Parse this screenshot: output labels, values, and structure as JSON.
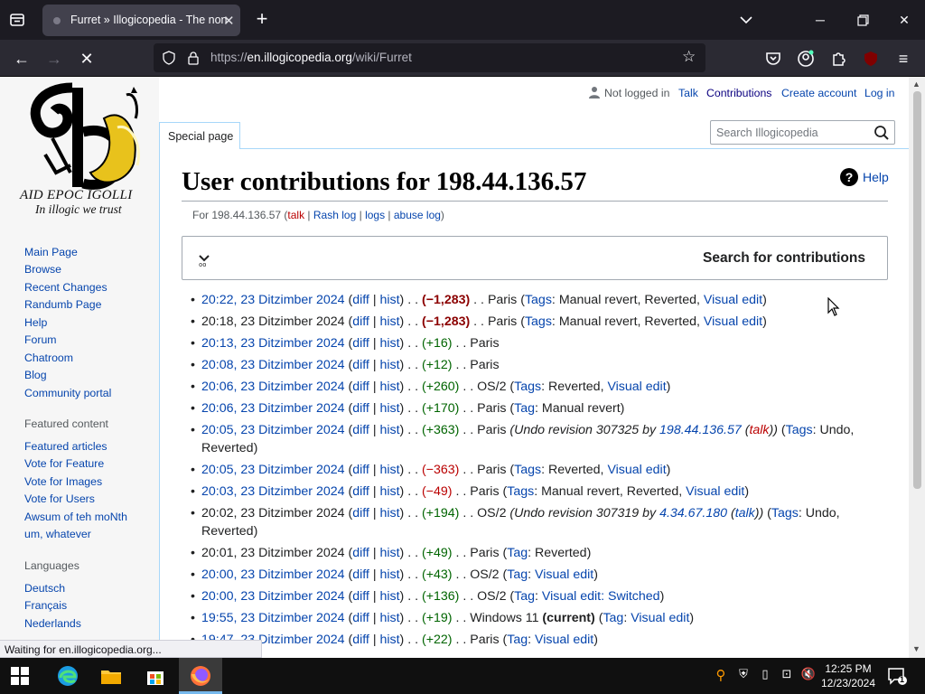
{
  "browser": {
    "tab_title": "Furret » Illogicopedia - The non",
    "url_host": "en.illogicopedia.org",
    "url_prefix": "https://",
    "url_path": "/wiki/Furret",
    "status_text": "Waiting for en.illogicopedia.org..."
  },
  "logo": {
    "line1": "AID EPOC IGOLLI",
    "line2": "In illogic we trust"
  },
  "sidebar": {
    "nav": [
      "Main Page",
      "Browse",
      "Recent Changes",
      "Randumb Page",
      "Help",
      "Forum",
      "Chatroom",
      "Blog",
      "Community portal"
    ],
    "featured_heading": "Featured content",
    "featured": [
      "Featured articles",
      "Vote for Feature",
      "Vote for Images",
      "Vote for Users",
      "Awsum of teh moNth",
      "um, whatever"
    ],
    "languages_heading": "Languages",
    "languages": [
      "Deutsch",
      "Français",
      "Nederlands"
    ]
  },
  "personal": {
    "not_logged_in": "Not logged in",
    "talk": "Talk",
    "contributions": "Contributions",
    "create_account": "Create account",
    "log_in": "Log in"
  },
  "search": {
    "placeholder": "Search Illogicopedia"
  },
  "tabs": {
    "special_page": "Special page"
  },
  "page": {
    "title": "User contributions for 198.44.136.57",
    "help": "Help",
    "for_label": "For 198.44.136.57 (",
    "talk": "talk",
    "rash_log": "Rash log",
    "logs": "logs",
    "abuse_log": "abuse log",
    "close_paren": ")",
    "search_contribs": "Search for contributions"
  },
  "contributions": [
    {
      "time": "20:22, 23 Ditzimber 2024",
      "linked": true,
      "diff": "diff",
      "hist": "hist",
      "size": "−1,283",
      "neg": true,
      "big": true,
      "page": "Paris",
      "tagword": "Tags",
      "tags": "Manual revert, Reverted, ",
      "tag_link": "Visual edit",
      "tag_tail": "",
      "note": ""
    },
    {
      "time": "20:18, 23 Ditzimber 2024",
      "linked": false,
      "diff": "diff",
      "hist": "hist",
      "size": "−1,283",
      "neg": true,
      "big": true,
      "page": "Paris",
      "tagword": "Tags",
      "tags": "Manual revert, Reverted, ",
      "tag_link": "Visual edit",
      "tag_tail": "",
      "note": ""
    },
    {
      "time": "20:13, 23 Ditzimber 2024",
      "linked": true,
      "diff": "diff",
      "hist": "hist",
      "size": "+16",
      "neg": false,
      "big": false,
      "page": "Paris",
      "tagword": "",
      "tags": "",
      "tag_link": "",
      "tag_tail": "",
      "note": ""
    },
    {
      "time": "20:08, 23 Ditzimber 2024",
      "linked": true,
      "diff": "diff",
      "hist": "hist",
      "size": "+12",
      "neg": false,
      "big": false,
      "page": "Paris",
      "tagword": "",
      "tags": "",
      "tag_link": "",
      "tag_tail": "",
      "note": ""
    },
    {
      "time": "20:06, 23 Ditzimber 2024",
      "linked": true,
      "diff": "diff",
      "hist": "hist",
      "size": "+260",
      "neg": false,
      "big": false,
      "page": "OS/2",
      "tagword": "Tags",
      "tags": "Reverted, ",
      "tag_link": "Visual edit",
      "tag_tail": "",
      "note": ""
    },
    {
      "time": "20:06, 23 Ditzimber 2024",
      "linked": true,
      "diff": "diff",
      "hist": "hist",
      "size": "+170",
      "neg": false,
      "big": false,
      "page": "Paris",
      "tagword": "Tag",
      "tags": "Manual revert",
      "tag_link": "",
      "tag_tail": "",
      "note": ""
    },
    {
      "time": "20:05, 23 Ditzimber 2024",
      "linked": true,
      "diff": "diff",
      "hist": "hist",
      "size": "+363",
      "neg": false,
      "big": false,
      "page": "Paris",
      "tagword": "Tags",
      "tags": "Undo, Reverted",
      "tag_link": "",
      "tag_tail": "",
      "note": "Undo revision 307325 by ",
      "note_user": "198.44.136.57",
      "note_talk": "talk",
      "note_talk_red": true
    },
    {
      "time": "20:05, 23 Ditzimber 2024",
      "linked": true,
      "diff": "diff",
      "hist": "hist",
      "size": "−363",
      "neg": true,
      "big": false,
      "page": "Paris",
      "tagword": "Tags",
      "tags": "Reverted, ",
      "tag_link": "Visual edit",
      "tag_tail": "",
      "note": ""
    },
    {
      "time": "20:03, 23 Ditzimber 2024",
      "linked": true,
      "diff": "diff",
      "hist": "hist",
      "size": "−49",
      "neg": true,
      "big": false,
      "page": "Paris",
      "tagword": "Tags",
      "tags": "Manual revert, Reverted, ",
      "tag_link": "Visual edit",
      "tag_tail": "",
      "note": ""
    },
    {
      "time": "20:02, 23 Ditzimber 2024",
      "linked": false,
      "diff": "diff",
      "hist": "hist",
      "size": "+194",
      "neg": false,
      "big": false,
      "page": "OS/2",
      "tagword": "Tags",
      "tags": "Undo, Reverted",
      "tag_link": "",
      "tag_tail": "",
      "note": "Undo revision 307319 by ",
      "note_user": "4.34.67.180",
      "note_talk": "talk",
      "note_talk_red": false
    },
    {
      "time": "20:01, 23 Ditzimber 2024",
      "linked": false,
      "diff": "diff",
      "hist": "hist",
      "size": "+49",
      "neg": false,
      "big": false,
      "page": "Paris",
      "tagword": "Tag",
      "tags": "Reverted",
      "tag_link": "",
      "tag_tail": "",
      "note": ""
    },
    {
      "time": "20:00, 23 Ditzimber 2024",
      "linked": true,
      "diff": "diff",
      "hist": "hist",
      "size": "+43",
      "neg": false,
      "big": false,
      "page": "OS/2",
      "tagword": "Tag",
      "tags": "",
      "tag_link": "Visual edit",
      "tag_tail": "",
      "note": ""
    },
    {
      "time": "20:00, 23 Ditzimber 2024",
      "linked": true,
      "diff": "diff",
      "hist": "hist",
      "size": "+136",
      "neg": false,
      "big": false,
      "page": "OS/2",
      "tagword": "Tag",
      "tags": "",
      "tag_link": "Visual edit: Switched",
      "tag_tail": "",
      "note": ""
    },
    {
      "time": "19:55, 23 Ditzimber 2024",
      "linked": true,
      "diff": "diff",
      "hist": "hist",
      "size": "+19",
      "neg": false,
      "big": false,
      "page": "Windows 11",
      "current": "(current)",
      "tagword": "Tag",
      "tags": "",
      "tag_link": "Visual edit",
      "tag_tail": "",
      "note": ""
    },
    {
      "time": "19:47, 23 Ditzimber 2024",
      "linked": true,
      "diff": "diff",
      "hist": "hist",
      "size": "+22",
      "neg": false,
      "big": false,
      "page": "Paris",
      "tagword": "Tag",
      "tags": "",
      "tag_link": "Visual edit",
      "tag_tail": "",
      "note": ""
    }
  ],
  "taskbar": {
    "time": "12:25 PM",
    "date": "12/23/2024",
    "notifications": "1"
  },
  "colors": {
    "link": "#0645ad",
    "negative": "#8b0000",
    "positive": "#006400",
    "browser_dark": "#1c1b22"
  }
}
